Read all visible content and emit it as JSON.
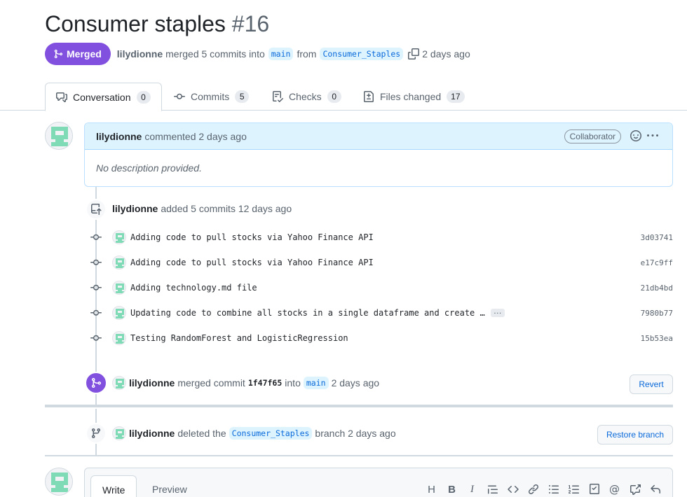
{
  "pr": {
    "title": "Consumer staples",
    "number": "#16",
    "state": "Merged",
    "author": "lilydionne",
    "merge_text": "merged 5 commits into",
    "base_branch": "main",
    "from_text": "from",
    "head_branch": "Consumer_Staples",
    "time": "2 days ago"
  },
  "tabs": [
    {
      "label": "Conversation",
      "count": "0",
      "icon": "comment-discussion-icon"
    },
    {
      "label": "Commits",
      "count": "5",
      "icon": "git-commit-icon"
    },
    {
      "label": "Checks",
      "count": "0",
      "icon": "checklist-icon"
    },
    {
      "label": "Files changed",
      "count": "17",
      "icon": "file-diff-icon"
    }
  ],
  "comment": {
    "author": "lilydionne",
    "action": "commented 2 days ago",
    "role": "Collaborator",
    "body": "No description provided."
  },
  "commits_event": {
    "author": "lilydionne",
    "action": "added 5 commits 12 days ago",
    "commits": [
      {
        "message": "Adding code to pull stocks via Yahoo Finance API",
        "sha": "3d03741"
      },
      {
        "message": "Adding code to pull stocks via Yahoo Finance API",
        "sha": "e17c9ff"
      },
      {
        "message": "Adding technology.md file",
        "sha": "21db4bd"
      },
      {
        "message": "Updating code to combine all stocks in a single dataframe and create …",
        "sha": "7980b77",
        "truncated": true
      },
      {
        "message": "Testing RandomForest and LogisticRegression",
        "sha": "15b53ea"
      }
    ]
  },
  "merge_event": {
    "author": "lilydionne",
    "action": "merged commit",
    "sha": "1f47f65",
    "into": "into",
    "branch": "main",
    "time": "2 days ago",
    "button": "Revert"
  },
  "delete_event": {
    "author": "lilydionne",
    "action": "deleted the",
    "branch": "Consumer_Staples",
    "suffix": "branch 2 days ago",
    "button": "Restore branch"
  },
  "editor": {
    "tabs": [
      "Write",
      "Preview"
    ],
    "tools": [
      "heading-icon",
      "bold-icon",
      "italic-icon",
      "quote-icon",
      "code-icon",
      "link-icon",
      "unordered-list-icon",
      "ordered-list-icon",
      "task-list-icon",
      "mention-icon",
      "cross-reference-icon",
      "reply-icon"
    ]
  },
  "colors": {
    "merged": "#8250df",
    "link": "#0969da",
    "comment_header": "#ddf4ff"
  }
}
